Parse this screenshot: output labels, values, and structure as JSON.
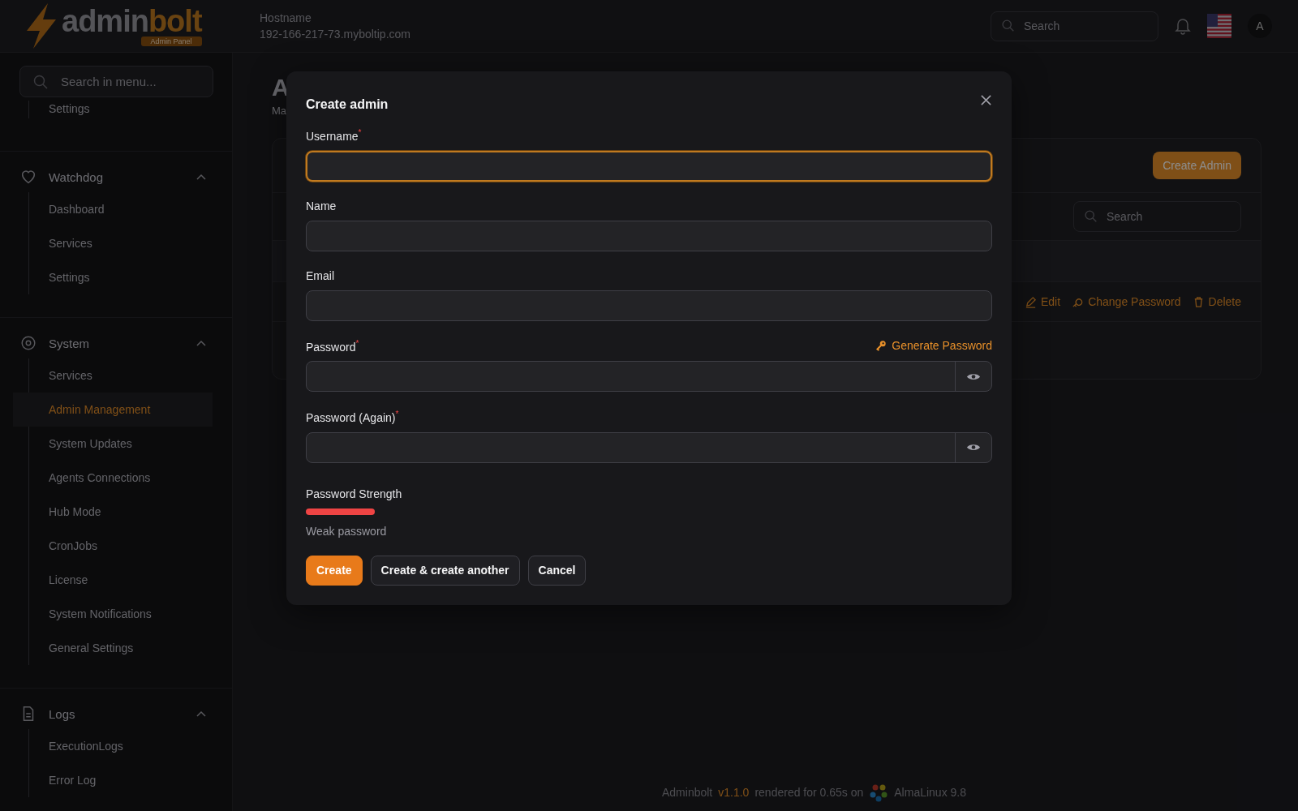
{
  "header": {
    "logo": {
      "part_1": "admin",
      "part_2": "bolt",
      "badge": "Admin Panel"
    },
    "hostname_label": "Hostname",
    "hostname": "192-166-217-73.myboltip.com",
    "search": {
      "placeholder": "Search"
    },
    "avatar": "A"
  },
  "sidebar": {
    "search": {
      "placeholder": "Search in menu..."
    },
    "top_item": "Settings",
    "groups": [
      {
        "title": "Watchdog",
        "expanded": true,
        "items": [
          {
            "label": "Dashboard",
            "selected": false
          },
          {
            "label": "Services",
            "selected": false
          },
          {
            "label": "Settings",
            "selected": false
          }
        ]
      },
      {
        "title": "System",
        "expanded": true,
        "items": [
          {
            "label": "Services",
            "selected": false
          },
          {
            "label": "Admin Management",
            "selected": true
          },
          {
            "label": "System Updates",
            "selected": false
          },
          {
            "label": "Agents Connections",
            "selected": false
          },
          {
            "label": "Hub Mode",
            "selected": false
          },
          {
            "label": "CronJobs",
            "selected": false
          },
          {
            "label": "License",
            "selected": false
          },
          {
            "label": "System Notifications",
            "selected": false
          },
          {
            "label": "General Settings",
            "selected": false
          }
        ]
      },
      {
        "title": "Logs",
        "expanded": true,
        "items": [
          {
            "label": "ExecutionLogs",
            "selected": false
          },
          {
            "label": "Error Log",
            "selected": false
          }
        ]
      }
    ]
  },
  "page": {
    "title": "A",
    "subtitle": "Ma",
    "create_button": "Create Admin",
    "search": {
      "placeholder": "Search"
    },
    "row_actions": [
      "Edit",
      "Change Password",
      "Delete"
    ]
  },
  "modal": {
    "title": "Create admin",
    "fields": [
      {
        "label": "Username",
        "required_mark": "*",
        "kind": "text",
        "focused": true
      },
      {
        "label": "Name",
        "kind": "text",
        "focused": false
      },
      {
        "label": "Email",
        "kind": "text",
        "focused": false
      },
      {
        "label": "Password",
        "required_mark": "*",
        "kind": "password",
        "focused": false,
        "action": "Generate Password"
      },
      {
        "label": "Password (Again)",
        "required_mark": "*",
        "kind": "password",
        "focused": false
      }
    ],
    "strength": {
      "label": "Password Strength",
      "level": 0.1,
      "reading": "Weak password"
    },
    "buttons": [
      {
        "label": "Create",
        "kind": "primary"
      },
      {
        "label": "Create & create another",
        "kind": "secondary"
      },
      {
        "label": "Cancel",
        "kind": "secondary"
      }
    ]
  },
  "footer": {
    "brand": "Adminbolt",
    "version": "v1.1.0",
    "text": "rendered for 0.65s on",
    "os": "AlmaLinux 9.8"
  }
}
